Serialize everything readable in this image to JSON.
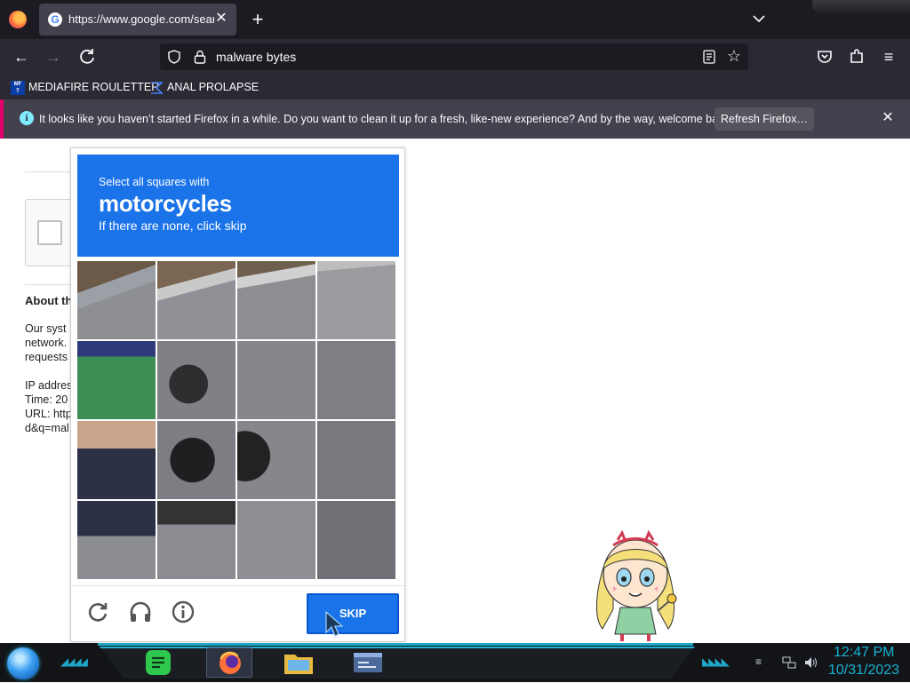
{
  "browser": {
    "tab": {
      "title": "https://www.google.com/search",
      "favicon": "google-icon"
    },
    "url": "malware bytes",
    "bookmarks": [
      {
        "label": "MEDIAFIRE ROULETTER",
        "icon": "mediafire-icon"
      },
      {
        "label": "ANAL PROLAPSE",
        "icon": "sigma-icon"
      }
    ],
    "notification": {
      "message": "It looks like you haven’t started Firefox in a while. Do you want to clean it up for a fresh, like-new experience? And by the way, welcome back!",
      "button": "Refresh Firefox…"
    }
  },
  "page": {
    "about_heading": "About th",
    "about_lines": [
      "Our syst",
      "network.",
      "requests"
    ],
    "info_lines": [
      "IP addres",
      "Time: 20",
      "URL: http",
      "d&q=mal"
    ]
  },
  "captcha": {
    "instruction": "Select all squares with",
    "target": "motorcycles",
    "hint": "If there are none, click skip",
    "skip_label": "SKIP",
    "footer_icons": [
      "reload-icon",
      "audio-icon",
      "info-icon"
    ],
    "accent": "#1a73e8"
  },
  "taskbar": {
    "apps": [
      "notes-app-icon",
      "firefox-icon",
      "file-manager-icon",
      "browser-window-icon"
    ],
    "time": "12:47 PM",
    "date": "10/31/2023",
    "accent": "#17b4d6"
  }
}
